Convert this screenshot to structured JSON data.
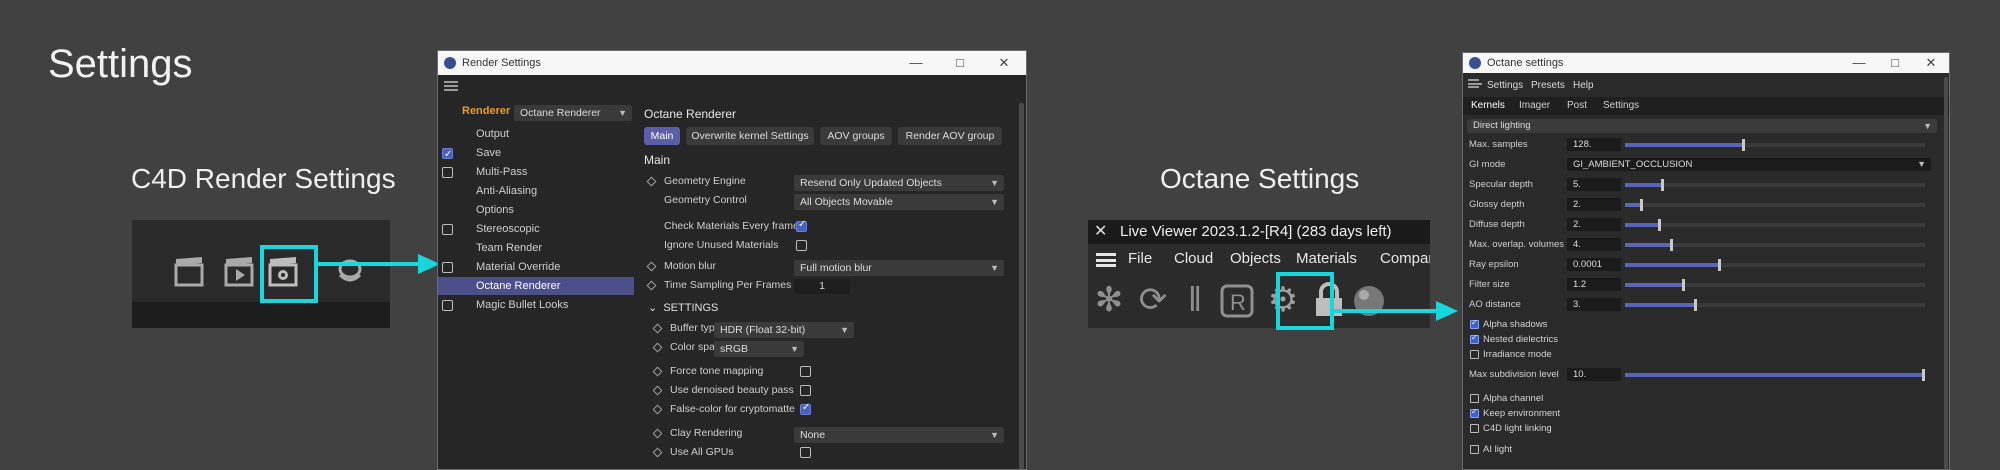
{
  "page": {
    "title": "Settings"
  },
  "c4d_section": {
    "title": "C4D Render Settings",
    "toolbar_icons": [
      "clapboard-icon",
      "play-clapboard-icon",
      "render-settings-icon",
      "coil-icon"
    ]
  },
  "render_settings": {
    "window_title": "Render Settings",
    "renderer_label": "Renderer",
    "renderer_value": "Octane Renderer",
    "nav": [
      {
        "label": "Output",
        "checkbox": null
      },
      {
        "label": "Save",
        "checkbox": true
      },
      {
        "label": "Multi-Pass",
        "checkbox": false
      },
      {
        "label": "Anti-Aliasing",
        "checkbox": null
      },
      {
        "label": "Options",
        "checkbox": null
      },
      {
        "label": "Stereoscopic",
        "checkbox": false
      },
      {
        "label": "Team Render",
        "checkbox": null
      },
      {
        "label": "Material Override",
        "checkbox": false
      },
      {
        "label": "Octane Renderer",
        "checkbox": null,
        "active": true
      },
      {
        "label": "Magic Bullet Looks",
        "checkbox": false
      }
    ],
    "heading": "Octane Renderer",
    "tabs": [
      "Main",
      "Overwrite kernel Settings",
      "AOV groups",
      "Render AOV group"
    ],
    "section_main": "Main",
    "geometry_engine_label": "Geometry Engine",
    "geometry_engine_value": "Resend Only Updated Objects",
    "geometry_control_label": "Geometry Control",
    "geometry_control_value": "All Objects Movable",
    "check_materials_label": "Check Materials Every frame",
    "ignore_unused_label": "Ignore Unused Materials",
    "motion_blur_label": "Motion blur",
    "motion_blur_value": "Full motion blur",
    "time_sampling_label": "Time Sampling Per Frames",
    "time_sampling_value": "1",
    "settings_heading": "SETTINGS",
    "buffer_type_label": "Buffer type",
    "buffer_type_value": "HDR (Float 32-bit)",
    "color_space_label": "Color space",
    "color_space_value": "sRGB",
    "force_tone_label": "Force tone mapping",
    "denoised_label": "Use denoised beauty pass",
    "false_color_label": "False-color for cryptomatte",
    "clay_label": "Clay Rendering",
    "clay_value": "None",
    "all_gpus_label": "Use All GPUs"
  },
  "octane_section": {
    "title": "Octane Settings",
    "live_viewer_title": "Live Viewer 2023.1.2-[R4] (283 days left)",
    "live_viewer_menu": [
      "File",
      "Cloud",
      "Objects",
      "Materials",
      "Compar"
    ],
    "live_viewer_icons": [
      "aperture-icon",
      "refresh-icon",
      "pause-icon",
      "region-render-icon",
      "gear-icon",
      "lock-icon",
      "sphere-icon"
    ]
  },
  "octane_settings": {
    "window_title": "Octane settings",
    "menu": [
      "Settings",
      "Presets",
      "Help"
    ],
    "tabs": [
      "Kernels",
      "Imager",
      "Post",
      "Settings"
    ],
    "kernel_value": "Direct lighting",
    "gi_mode_label": "GI mode",
    "gi_mode_value": "GI_AMBIENT_OCCLUSION",
    "params": [
      {
        "label": "Max. samples",
        "value": "128.",
        "fraction": 0.39
      },
      {
        "label": "Specular depth",
        "value": "5.",
        "fraction": 0.12
      },
      {
        "label": "Glossy depth",
        "value": "2.",
        "fraction": 0.05
      },
      {
        "label": "Diffuse depth",
        "value": "2.",
        "fraction": 0.11
      },
      {
        "label": "Max. overlap. volumes",
        "value": "4.",
        "fraction": 0.15
      },
      {
        "label": "Ray epsilon",
        "value": "0.0001",
        "fraction": 0.31
      },
      {
        "label": "Filter size",
        "value": "1.2",
        "fraction": 0.19
      },
      {
        "label": "AO distance",
        "value": "3.",
        "fraction": 0.23
      }
    ],
    "checks_a": [
      {
        "label": "Alpha shadows",
        "checked": true
      },
      {
        "label": "Nested dielectrics",
        "checked": true
      },
      {
        "label": "Irradiance mode",
        "checked": false
      }
    ],
    "max_subdiv_label": "Max subdivision level",
    "max_subdiv_value": "10.",
    "max_subdiv_fraction": 1.0,
    "checks_b": [
      {
        "label": "Alpha channel",
        "checked": false
      },
      {
        "label": "Keep environment",
        "checked": true
      },
      {
        "label": "C4D light linking",
        "checked": false
      }
    ],
    "ai_light_label": "AI light"
  },
  "colors": {
    "highlight": "#19d6dc",
    "accent": "#5a5fa8",
    "background": "#414141"
  }
}
